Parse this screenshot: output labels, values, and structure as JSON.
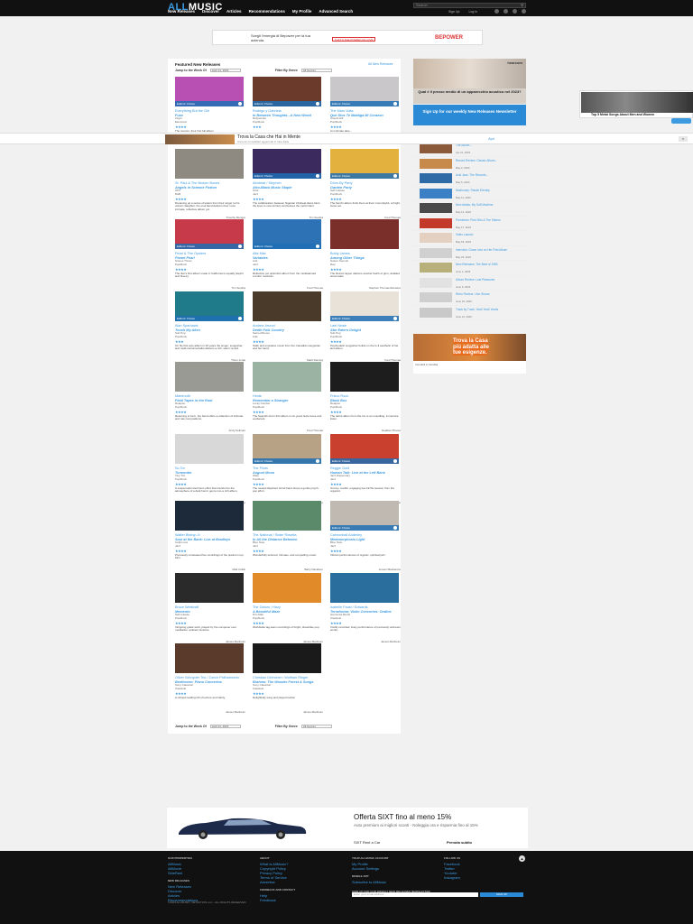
{
  "header": {
    "logo_all": "ALL",
    "logo_music": "MUSIC",
    "nav": [
      "New Releases",
      "Discover",
      "Articles",
      "Recommendations",
      "My Profile",
      "Advanced Search"
    ],
    "search_placeholder": "Search",
    "links": [
      "Sign Up",
      "Log In"
    ]
  },
  "top_ad": {
    "text": "Scegli l'energia di Bepower per la tua azienda.",
    "cta": "THAT'S THE POWER OF LOVE",
    "brand": "BEPOWER"
  },
  "main": {
    "title": "Featured New Releases",
    "all_link": "All New Releases",
    "filters": {
      "jump_label": "Jump to the Week Of",
      "jump_value": "April 21, 2023",
      "genre_label": "Filter By Genre",
      "genre_value": "All Genres"
    },
    "albums": [
      {
        "artist": "Everything But the Girl",
        "title": "Fuse",
        "label": "Virgin",
        "genre": "Electronic",
        "stars": "★★★★",
        "desc": "The reunion, their first full album",
        "critic": "",
        "color": "#b84fb3",
        "has_badge": true
      },
      {
        "artist": "Rodrigo y Gabriela",
        "title": "In Between Thoughts...A New World",
        "label": "Rubyworks",
        "genre": "Pop/Rock",
        "stars": "★★★",
        "desc": "",
        "critic": "",
        "color": "#6b3a2a",
        "has_badge": true
      },
      {
        "artist": "The Mars Volta",
        "title": "Que Dios Te Maldiga Mi Corazon",
        "label": "Clouds Hill",
        "genre": "Pop/Rock",
        "stars": "★★★★",
        "desc": "An intimate take...",
        "critic": "",
        "color": "#c9c7c9",
        "has_badge": true
      },
      {
        "artist": "St. Paul & The Broken Bones",
        "title": "Angels in Science Fiction",
        "label": "ATO",
        "genre": "R&B",
        "stars": "★★★★",
        "desc": "Dreaming up a series of letters from their singer to his unborn daughter, the soul band delivers their most intimate, reflective album yet.",
        "critic": "Timothy Monger",
        "color": "#8e8a82",
        "has_badge": false
      },
      {
        "artist": "Afrobeat / Stephen",
        "title": "Afro-Black Music Staple",
        "label": "Strut",
        "genre": "Jazz",
        "stars": "★★★★",
        "desc": "The collaboration between Nigerian Afrobeat titans blurs the lines to new territory and leaves the mold intact.",
        "critic": "Tim Sendra",
        "color": "#3b2a5e",
        "has_badge": true
      },
      {
        "artist": "Drive-By Party",
        "title": "Garden Party",
        "label": "Self-release",
        "genre": "Pop/Rock",
        "stars": "★★★★",
        "desc": "The band's album finds them at their most playful, a bright, loose set.",
        "critic": "Fred Thomas",
        "color": "#e3b13e",
        "has_badge": true
      },
      {
        "artist": "Pearl & The Oysters",
        "title": "Planet Pearl",
        "label": "Stones Throw",
        "genre": "Pop/Rock",
        "stars": "★★★★",
        "desc": "The duo's first album made in California is equally playful and breezy.",
        "critic": "Tim Sendra",
        "color": "#c73a4a",
        "has_badge": true
      },
      {
        "artist": "Alfa Mist",
        "title": "Variables",
        "label": "Anti-",
        "genre": "Jazz",
        "stars": "★★★★",
        "desc": "Reflective yet optimistic album from the multitalented London musician.",
        "critic": "Fred Thomas",
        "color": "#2e72b6",
        "has_badge": true
      },
      {
        "artist": "Boldy James",
        "title": "Among Other Things",
        "label": "Nature Sounds",
        "genre": "Rap",
        "stars": "★★★★",
        "desc": "The Detroit rapper delivers another batch of grim, detailed street tales.",
        "critic": "Stephen Thomas Erlewine",
        "color": "#7a2f2a",
        "has_badge": false
      },
      {
        "artist": "Alan Sparhawk",
        "title": "Touch My Alien",
        "label": "Sub Pop",
        "genre": "Pop/Rock",
        "stars": "★★★",
        "desc": "On his first solo album in 20 years the singer, songwriter, and multi-instrumentalist delivers a rich, warm record.",
        "critic": "Thom Jurek",
        "color": "#1f7a8a",
        "has_badge": true
      },
      {
        "artist": "Andrea Jeunot",
        "title": "Death Folk Country",
        "label": "Sacred Bones",
        "genre": "Folk",
        "stars": "★★★★",
        "desc": "Stark and evocative music from the Canadian songwriter and her band.",
        "critic": "Mark Deming",
        "color": "#4a3a2a",
        "has_badge": false
      },
      {
        "artist": "Lael Neale",
        "title": "Star Eaters Delight",
        "label": "Sub Pop",
        "genre": "Pop/Rock",
        "stars": "★★★★",
        "desc": "Psychedelic songwriter builds on the lo-fi aesthetic of her last album.",
        "critic": "Fred Thomas",
        "color": "#e8e2d8",
        "has_badge": true
      },
      {
        "artist": "Mammoth",
        "title": "Field Tapes in the Rust",
        "label": "Relapse",
        "genre": "Pop/Rock",
        "stars": "★★★★",
        "desc": "Returning to form, the band offers a collection of intimate and raw compositions.",
        "critic": "Andy Kellman",
        "color": "#9a9a94",
        "has_badge": false
      },
      {
        "artist": "Hinds",
        "title": "Remember a Stranger",
        "label": "Lucky Number",
        "genre": "Pop/Rock",
        "stars": "★★★★",
        "desc": "The Spanish duo's first album in six years feels loose and exuberant.",
        "critic": "Fred Thomas",
        "color": "#9bb3a3",
        "has_badge": false
      },
      {
        "artist": "Frisco Rock",
        "title": "Black Box",
        "label": "Relapse",
        "genre": "Pop/Rock",
        "stars": "★★★★",
        "desc": "The debut album from the trio is an unsettling, immersive listen.",
        "critic": "Heather Phares",
        "color": "#1d1d1d",
        "has_badge": false
      },
      {
        "artist": "So Tor",
        "title": "Tormenter",
        "label": "Tiny Tim",
        "genre": "Pop/Rock",
        "stars": "★★★★",
        "desc": "A suspenseful electronic effort that transforms the atmosphere of a dark horror genre into a rich album.",
        "critic": "Paul Simpson",
        "color": "#d8d8d8",
        "has_badge": false
      },
      {
        "artist": "The Pilots",
        "title": "August Moon",
        "label": "Warp",
        "genre": "Pop/Rock",
        "stars": "★★★★",
        "desc": "The newest Elephant Grind band drops a gentle psych-pop effort.",
        "critic": "Timothy Monger",
        "color": "#b7a285",
        "has_badge": true
      },
      {
        "artist": "Reggie Gold",
        "title": "Human Talk: Live at the Left Bank",
        "label": "Jazz Dispensary",
        "genre": "Jazz",
        "stars": "★★★★",
        "desc": "Groovy, soulful, engaging live 1970s session from the organist.",
        "critic": "Matt Collar",
        "color": "#c9402f",
        "has_badge": true
      },
      {
        "artist": "Walter Bishop Jr.",
        "title": "Soul at the Bank: Live at Bradleys",
        "label": "Cellar Live",
        "genre": "Jazz",
        "stars": "★★★★",
        "desc": "Previously unreleased live recordings of the pianist in top form.",
        "critic": "Matt Collar",
        "color": "#1c2a3a",
        "has_badge": false
      },
      {
        "artist": "The National / Sister Rosetta",
        "title": "In All the Distance Between",
        "label": "Blue Note",
        "genre": "Jazz",
        "stars": "★★★★",
        "desc": "Wonderfully textured, intimate, and compelling music.",
        "critic": "Barry Davidson",
        "color": "#5a8a6a",
        "has_badge": false
      },
      {
        "artist": "Cannonball Adderley",
        "title": "Metamorphosis Light",
        "label": "Blue Note",
        "genre": "Jazz",
        "stars": "★★★★",
        "desc": "Vibrant performances of organic, spiritual jazz.",
        "critic": "Jeroen Mackenzie",
        "color": "#bfb9b2",
        "has_badge": true
      },
      {
        "artist": "Bruce Wetstraff",
        "title": "Memento",
        "label": "Self-release",
        "genre": "Pop/Rock",
        "stars": "★★★★",
        "desc": "Intriguing guitar work, played by the composer over meditative, ambient textures.",
        "critic": "James Manheim",
        "color": "#2a2a2a",
        "has_badge": false
      },
      {
        "artist": "The Gators / Hazy",
        "title": "A Beautiful Maze",
        "label": "Dim Mak",
        "genre": "Pop/Rock",
        "stars": "★★★★",
        "desc": "Worldwide tag-team recordings of bright, dreamlike pop.",
        "critic": "James Manheim",
        "color": "#e08a2a",
        "has_badge": false
      },
      {
        "artist": "Isabelle Faust / Edwards",
        "title": "Terraforma: Violin Concertos: Ondine",
        "label": "Harmonia Mundi",
        "genre": "Classical",
        "stars": "★★★★",
        "desc": "Vividly recorded, lively performance of previously unknown works.",
        "critic": "James Manheim",
        "color": "#2a6e9e",
        "has_badge": false
      },
      {
        "artist": "Oliver Schnyder Trio / Zurich Philharmonic",
        "title": "Beethoven: Piano Concertos",
        "label": "Sony Classical",
        "genre": "Classical",
        "stars": "★★★★",
        "desc": "A refined reading full of texture and clarity.",
        "critic": "James Manheim",
        "color": "#5a3a2a",
        "has_badge": false
      },
      {
        "artist": "Christian Gerhaher / Wolfram Rieger",
        "title": "Brahms: The Wonder Forest & Songs",
        "label": "Sony Classical",
        "genre": "Classical",
        "stars": "★★★★",
        "desc": "Delightfully sung and played recital.",
        "critic": "James Manheim",
        "color": "#1a1a1a",
        "has_badge": false
      }
    ]
  },
  "sidebar": {
    "ad_brand": "hearcom",
    "ad_question": "Qual è il prezzo medio di un apparecchio acustico nel 2023?",
    "signup": "Sign Up for our weekly New Releases Newsletter",
    "items": [
      {
        "title": "The Album...",
        "date": "Apr 21, 2023",
        "color": "#8a5a3a"
      },
      {
        "title": "Record Review: Classic Album...",
        "date": "May 2, 2023",
        "color": "#c78a4a"
      },
      {
        "title": "Acid Jazz: The Records...",
        "date": "May 5, 2023",
        "color": "#2e6aa5"
      },
      {
        "title": "Mudhoney: Plastic Eternity",
        "date": "May 11, 2023",
        "color": "#3b7fc4"
      },
      {
        "title": "New Artists: My Soft Machine",
        "date": "May 12, 2023",
        "color": "#4a4a4a"
      },
      {
        "title": "Premieres: Pink Siifu & The Sisters",
        "date": "May 17, 2023",
        "color": "#c43a2a"
      },
      {
        "title": "Video Launch",
        "date": "May 18, 2023",
        "color": "#e4d0c0"
      },
      {
        "title": "Interview: Grace Ives on Her First Album",
        "date": "May 23, 2023",
        "color": "#d0d0d0"
      },
      {
        "title": "New Releases: The Best of 1983",
        "date": "June 1, 2023",
        "color": "#b7b07a"
      },
      {
        "title": "Album Review: Lost Pleasures",
        "date": "June 9, 2023",
        "color": "#e2e2e2"
      },
      {
        "title": "Retro Review: I Am Shana",
        "date": "June 15, 2023",
        "color": "#cfcfcf"
      },
      {
        "title": "Track by Track: Yeah Yeah Yeahs",
        "date": "June 21, 2023",
        "color": "#c9c9c9"
      }
    ],
    "ad2_text1": "Trova la Casa",
    "ad2_text2": "più adatta alle",
    "ad2_text3": "tue esigenze.",
    "ad2_foot": "Immobili in Vendita"
  },
  "float_ad": {
    "text": "Top 5 Metal Songs About Men and Women"
  },
  "strip_ad": {
    "title": "Trova la Casa che Hai in Mente",
    "sub": "Annunci immobiliari aggiornati in tutta Italia",
    "cta": "Apri",
    "close": "x"
  },
  "bottom_ad": {
    "title": "Offerta SIXT fino al meno 15%",
    "text": "Auto premium ai migliori sconti - Noleggia ora e risparmia fino al 15%",
    "brand": "SIXT Rent a Car",
    "cta": "Prenota subito"
  },
  "footer": {
    "cols": [
      {
        "head": "OUR PROPERTIES",
        "links": [
          "AllMusic",
          "AllMovie",
          "SideReel"
        ]
      },
      {
        "head": "ABOUT",
        "links": [
          "What is AllMusic?",
          "Copyright Policy",
          "Privacy Policy",
          "Terms of Service",
          "Advertise"
        ]
      },
      {
        "head": "YOUR ALLMUSIC ACCOUNT",
        "links": [
          "My Profile",
          "Account Settings"
        ]
      },
      {
        "head": "FOLLOW US",
        "links": [
          "Facebook",
          "Twitter",
          "Youtube",
          "Instagram"
        ]
      }
    ],
    "subhead": "NEW RELEASES",
    "sub_links": [
      "New Releases",
      "Discover",
      "Articles",
      "Recommendations"
    ],
    "feedback_head": "FEEDBACK AND CONTACT",
    "feedback_links": [
      "Help",
      "Feedback"
    ],
    "mobile_head": "MOBILE APP",
    "mobile_link": "Subscribe to AllMusic",
    "newsletter_head": "SIGN UP FOR OUR WEEKLY NEW RELEASES NEWSLETTER",
    "newsletter_placeholder": "Enter your email address",
    "newsletter_btn": "SIGN UP",
    "copyright": "©2023 ALLMUSIC, NETAKTION LLC - ALL RIGHTS RESERVED",
    "up": "▲"
  }
}
